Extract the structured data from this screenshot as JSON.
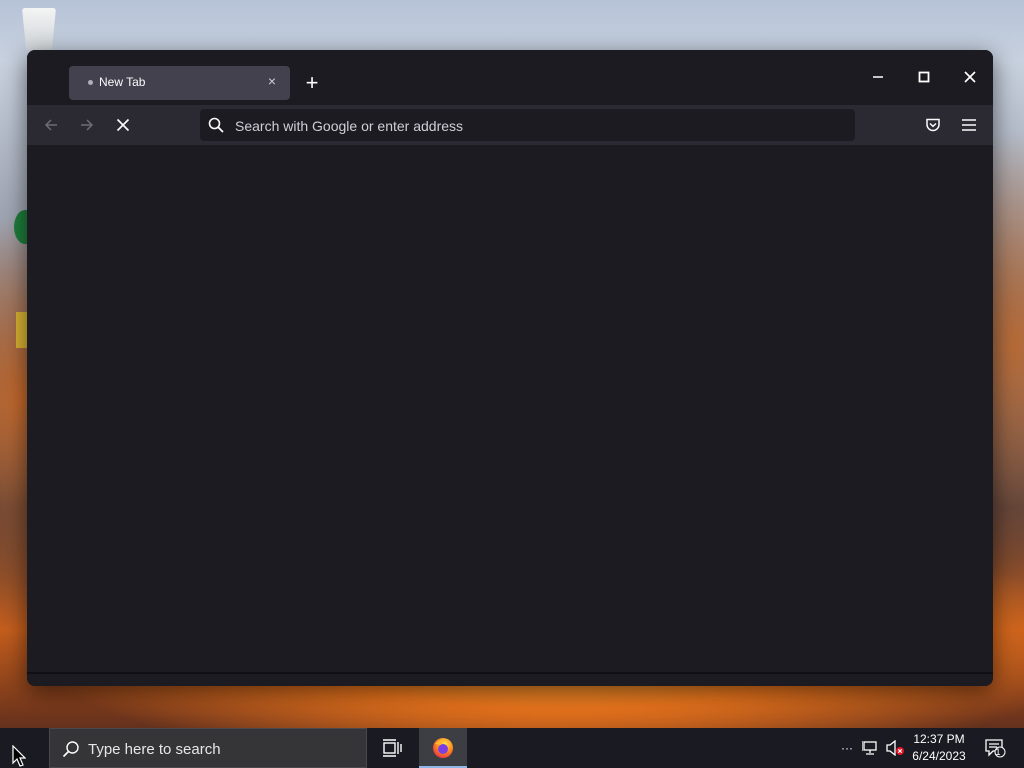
{
  "browser": {
    "tab_title": "New Tab",
    "close_tab_glyph": "×",
    "new_tab_glyph": "+",
    "address_placeholder": "Search with Google or enter address"
  },
  "taskbar": {
    "search_placeholder": "Type here to search",
    "time": "12:37 PM",
    "date": "6/24/2023",
    "notifications_count": "1",
    "overflow_glyph": "···"
  },
  "colors": {
    "window_bg": "#1c1b22",
    "toolbar_bg": "#2b2a33",
    "tab_bg": "#42414d",
    "taskbar_bg": "#1a1a22"
  },
  "icons": [
    "recycle-bin-icon",
    "back-arrow-icon",
    "forward-arrow-icon",
    "stop-icon",
    "search-icon",
    "pocket-icon",
    "menu-icon",
    "minimize-icon",
    "maximize-icon",
    "close-icon",
    "firefox-icon",
    "task-view-icon",
    "network-icon",
    "volume-muted-icon",
    "notification-icon"
  ]
}
